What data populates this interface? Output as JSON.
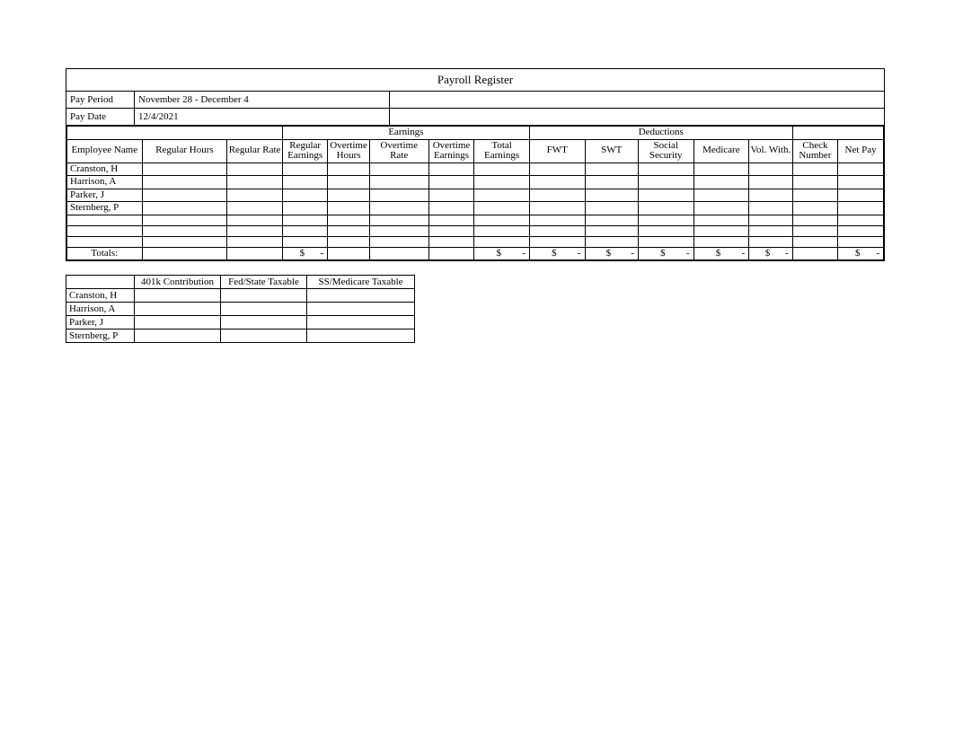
{
  "title": "Payroll Register",
  "meta": {
    "period_label": "Pay Period",
    "period_value": "November 28 - December 4",
    "date_label": "Pay Date",
    "date_value": "12/4/2021"
  },
  "group_headers": {
    "earnings": "Earnings",
    "deductions": "Deductions"
  },
  "columns": {
    "employee": "Employee Name",
    "reg_hours": "Regular Hours",
    "reg_rate": "Regular Rate",
    "reg_earn": "Regular Earnings",
    "ot_hours": "Overtime Hours",
    "ot_rate": "Overtime Rate",
    "ot_earn": "Overtime Earnings",
    "total_earn": "Total Earnings",
    "fwt": "FWT",
    "swt": "SWT",
    "ss": "Social Security",
    "medicare": "Medicare",
    "vol_with": "Vol. With.",
    "check_no": "Check Number",
    "net_pay": "Net Pay"
  },
  "employees": [
    {
      "name": "Cranston, H"
    },
    {
      "name": "Harrison, A"
    },
    {
      "name": "Parker, J"
    },
    {
      "name": "Sternberg, P"
    }
  ],
  "blank_rows": 3,
  "totals_label": "Totals:",
  "money_placeholder": {
    "symbol": "$",
    "dash": "-"
  },
  "sub_columns": {
    "c401k": "401k Contribution",
    "fed_state": "Fed/State Taxable",
    "ss_med": "SS/Medicare Taxable"
  },
  "chart_data": {
    "type": "table",
    "title": "Payroll Register",
    "pay_period": "November 28 - December 4",
    "pay_date": "12/4/2021",
    "main_table": {
      "columns": [
        "Employee Name",
        "Regular Hours",
        "Regular Rate",
        "Regular Earnings",
        "Overtime Hours",
        "Overtime Rate",
        "Overtime Earnings",
        "Total Earnings",
        "FWT",
        "SWT",
        "Social Security",
        "Medicare",
        "Vol. With.",
        "Check Number",
        "Net Pay"
      ],
      "rows": [
        {
          "Employee Name": "Cranston, H"
        },
        {
          "Employee Name": "Harrison, A"
        },
        {
          "Employee Name": "Parker, J"
        },
        {
          "Employee Name": "Sternberg, P"
        }
      ],
      "totals": {
        "Regular Earnings": "$ -",
        "Total Earnings": "$ -",
        "FWT": "$ -",
        "SWT": "$ -",
        "Social Security": "$ -",
        "Medicare": "$ -",
        "Vol. With.": "$ -",
        "Net Pay": "$ -"
      }
    },
    "sub_table": {
      "columns": [
        "Employee Name",
        "401k Contribution",
        "Fed/State Taxable",
        "SS/Medicare Taxable"
      ],
      "rows": [
        {
          "Employee Name": "Cranston, H"
        },
        {
          "Employee Name": "Harrison, A"
        },
        {
          "Employee Name": "Parker, J"
        },
        {
          "Employee Name": "Sternberg, P"
        }
      ]
    }
  }
}
